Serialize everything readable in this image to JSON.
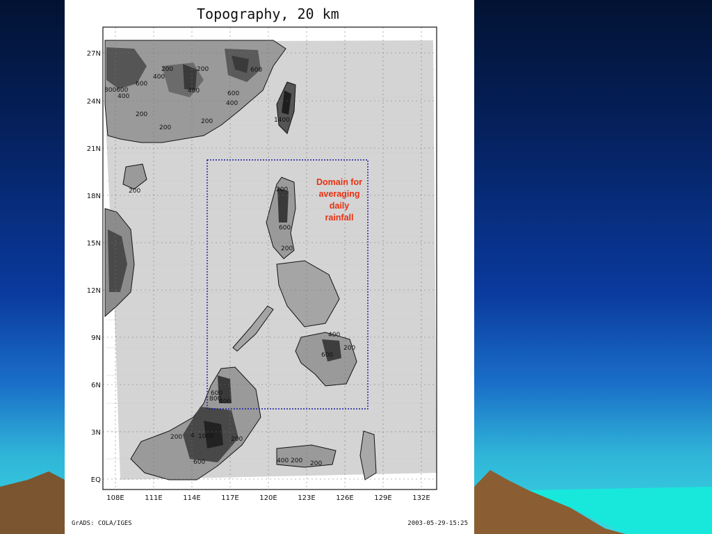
{
  "title": "Topography, 20 km",
  "annotation": {
    "line1": "Domain for",
    "line2": "averaging",
    "line3": "daily",
    "line4": "rainfall",
    "color": "#e83010"
  },
  "axes": {
    "lon_ticks": [
      "108E",
      "111E",
      "114E",
      "117E",
      "120E",
      "123E",
      "126E",
      "129E",
      "132E"
    ],
    "lat_ticks": [
      "27N",
      "24N",
      "21N",
      "18N",
      "15N",
      "12N",
      "9N",
      "6N",
      "3N",
      "EQ"
    ]
  },
  "contour_labels": [
    "200",
    "600",
    "200",
    "400",
    "600",
    "800600",
    "400",
    "200",
    "400",
    "600",
    "400",
    "200",
    "200",
    "1400",
    "200",
    "600",
    "200",
    "400",
    "200",
    "600",
    "200",
    "600",
    "800",
    "400",
    "200",
    "4",
    "1000",
    "200",
    "600",
    "400",
    "200",
    "200"
  ],
  "footer": {
    "left": "GrADS: COLA/IGES",
    "right": "2003-05-29-15:25"
  },
  "colors": {
    "ocean": "#d4d4d4",
    "land_low": "#9a9a9a",
    "land_high": "#2a2a2a",
    "domain_box": "#1a1aa0"
  }
}
